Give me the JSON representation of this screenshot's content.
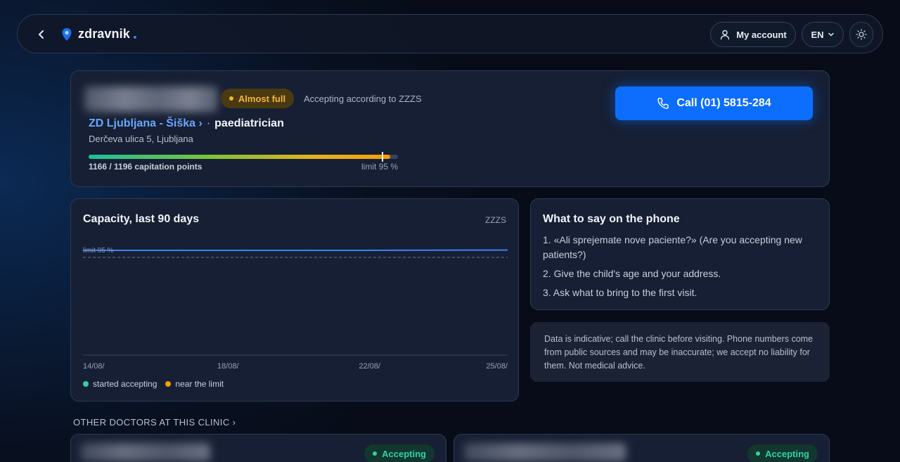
{
  "header": {
    "brand": "zdravnik",
    "account_label": "My account",
    "language": "EN"
  },
  "doctor": {
    "status_badge": "Almost full",
    "accepting_note": "Accepting according to ZZZS",
    "clinic": "ZD Ljubljana - Šiška ›",
    "separator": "·",
    "specialty": "paediatrician",
    "address": "Derčeva ulica 5, Ljubljana",
    "points_label": "1166 / 1196 capitation points",
    "points_current": 1166,
    "points_max": 1196,
    "limit_label": "limit 95 %",
    "limit_fraction": 0.95,
    "call_label": "Call (01) 5815-284"
  },
  "capacity": {
    "title": "Capacity, last 90 days",
    "source": "ZZZS",
    "legend": {
      "started": "started accepting",
      "near": "near the limit"
    }
  },
  "chart_data": {
    "type": "line",
    "title": "Capacity, last 90 days",
    "x": [
      "14/08/",
      "18/08/",
      "22/08/",
      "25/08/"
    ],
    "series": [
      {
        "values": [
          0.975,
          0.975,
          0.975,
          0.976
        ]
      }
    ],
    "ylim": [
      0,
      1
    ],
    "reference_line": {
      "label": "limit 95 %",
      "value": 0.95
    },
    "colors": {
      "line": "#3b82f6",
      "started": "#2fd3a6",
      "near": "#f59e0b"
    },
    "grid": false
  },
  "phone": {
    "title": "What to say on the phone",
    "steps": [
      "1. «Ali sprejemate nove paciente?» (Are you accepting new patients?)",
      "2. Give the child's age and your address.",
      "3. Ask what to bring to the first visit."
    ]
  },
  "disclaimer": "Data is indicative; call the clinic before visiting. Phone numbers come from public sources and may be inaccurate; we accept no liability for them. Not medical advice.",
  "other_doctors": {
    "heading": "OTHER DOCTORS AT THIS CLINIC ›",
    "cards": [
      {
        "status": "Accepting"
      },
      {
        "status": "Accepting"
      }
    ]
  },
  "colors": {
    "accent": "#0d6efd",
    "link": "#6aa7ff",
    "warning": "#f2b33d",
    "success": "#2fd3a6"
  },
  "icons": {
    "back": "chevron-left-icon",
    "brand": "location-pin-icon",
    "account": "user-icon",
    "language": "chevron-down-icon",
    "theme": "sun-icon",
    "call": "phone-icon"
  }
}
